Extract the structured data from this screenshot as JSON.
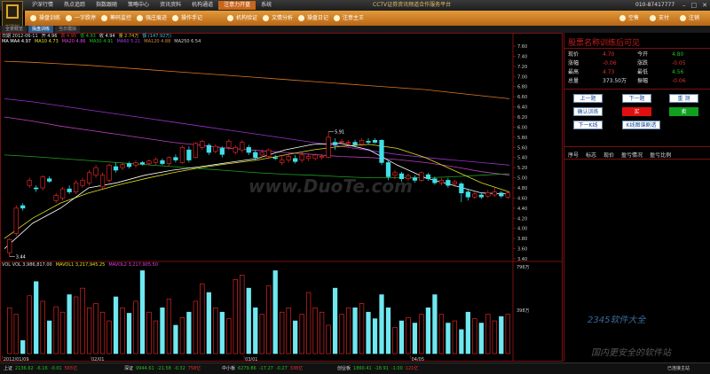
{
  "titlebar": {
    "center": "CCTV证券资讯频道合作服务平台",
    "phone": "010-87417777",
    "menu": [
      "沪深行情",
      "热点追踪",
      "指数跟随",
      "策略中心",
      "资讯资料",
      "机构通道",
      "注意力开盘",
      "系统"
    ],
    "active_menu_index": 6
  },
  "logo_text": "空间时光",
  "toolbar": {
    "items": [
      "操盘训练",
      "一字跌停",
      "筹码监控",
      "强庄痕迹",
      "操作手记",
      "机构验证",
      "文情分析",
      "操盘日记",
      "注意主王"
    ],
    "right_items": [
      "空售",
      "支付",
      "注销"
    ]
  },
  "tabs": [
    "全景概览",
    "操盘训练",
    "当日模拟"
  ],
  "active_tab": 1,
  "chart_info": {
    "line1": [
      {
        "text": "日期 2012-06-11",
        "color": "#dddddd"
      },
      {
        "text": "开 4.96",
        "color": "#e0e0e0"
      },
      {
        "text": "高 4.95",
        "color": "#e03030"
      },
      {
        "text": "低 4.93",
        "color": "#20c020"
      },
      {
        "text": "收 4.94",
        "color": "#e0e0e0"
      },
      {
        "text": "量 2.74万",
        "color": "#e0c020"
      },
      {
        "text": "额 (147.92万)",
        "color": "#40c0e0"
      }
    ],
    "line2": [
      {
        "text": "MA MA4 4.97",
        "color": "#ffffff"
      },
      {
        "text": "MA10 4.73",
        "color": "#e0e020"
      },
      {
        "text": "MA20 4.86",
        "color": "#e040e0"
      },
      {
        "text": "MA30 4.91",
        "color": "#20c020"
      },
      {
        "text": "MA60 5.21",
        "color": "#9a40e0"
      },
      {
        "text": "MA120 4.88",
        "color": "#e08040"
      },
      {
        "text": "MA250 6.54",
        "color": "#d0d0d0"
      }
    ],
    "vol": [
      {
        "text": "VOL VOL 3,986,817.00",
        "color": "#dddddd"
      },
      {
        "text": "MAVOL1 3,217,945.25",
        "color": "#e0e020"
      },
      {
        "text": "MAVOL2 3,217,905.50",
        "color": "#e040e0"
      }
    ]
  },
  "price_ticks": [
    "7.60",
    "7.40",
    "7.20",
    "7.00",
    "6.80",
    "6.60",
    "6.40",
    "6.20",
    "6.00",
    "5.80",
    "5.60",
    "5.40",
    "5.20",
    "5.00",
    "4.80",
    "4.60",
    "4.40",
    "4.20",
    "4.00",
    "3.80",
    "3.60",
    "3.40"
  ],
  "vol_ticks": [
    "796万",
    "398万"
  ],
  "date_ticks": [
    {
      "label": "2012/01/09",
      "pos": 0.003
    },
    {
      "label": "02/01",
      "pos": 0.175
    },
    {
      "label": "03/01",
      "pos": 0.475
    },
    {
      "label": "04/05",
      "pos": 0.8
    }
  ],
  "annotations": {
    "high": "5.91",
    "low": "3.44"
  },
  "watermark": "www.DuoTe.com",
  "chart_data": {
    "type": "candlestick",
    "ylim": [
      3.4,
      7.6
    ],
    "candles": [
      {
        "o": 3.52,
        "c": 3.78,
        "h": 3.8,
        "l": 3.44
      },
      {
        "o": 3.9,
        "c": 4.4,
        "h": 4.45,
        "l": 3.85
      },
      {
        "o": 4.45,
        "c": 4.4,
        "h": 4.5,
        "l": 4.35
      },
      {
        "o": 4.85,
        "c": 4.95,
        "h": 5.0,
        "l": 4.8
      },
      {
        "o": 4.8,
        "c": 4.78,
        "h": 4.85,
        "l": 4.72
      },
      {
        "o": 4.8,
        "c": 5.02,
        "h": 5.05,
        "l": 4.75
      },
      {
        "o": 4.98,
        "c": 4.93,
        "h": 5.03,
        "l": 4.9
      },
      {
        "o": 4.55,
        "c": 4.65,
        "h": 4.7,
        "l": 4.5
      },
      {
        "o": 4.6,
        "c": 4.78,
        "h": 4.82,
        "l": 4.55
      },
      {
        "o": 4.78,
        "c": 4.72,
        "h": 4.85,
        "l": 4.68
      },
      {
        "o": 4.72,
        "c": 4.9,
        "h": 4.95,
        "l": 4.68
      },
      {
        "o": 4.85,
        "c": 4.95,
        "h": 5.0,
        "l": 4.8
      },
      {
        "o": 4.9,
        "c": 5.1,
        "h": 5.15,
        "l": 4.85
      },
      {
        "o": 5.05,
        "c": 5.2,
        "h": 5.25,
        "l": 5.0
      },
      {
        "o": 4.82,
        "c": 5.05,
        "h": 5.1,
        "l": 4.78
      },
      {
        "o": 4.95,
        "c": 5.25,
        "h": 5.28,
        "l": 4.9
      },
      {
        "o": 5.22,
        "c": 5.15,
        "h": 5.3,
        "l": 5.1
      },
      {
        "o": 5.2,
        "c": 5.26,
        "h": 5.3,
        "l": 5.15
      },
      {
        "o": 5.28,
        "c": 5.22,
        "h": 5.32,
        "l": 5.18
      },
      {
        "o": 5.25,
        "c": 5.3,
        "h": 5.34,
        "l": 5.2
      },
      {
        "o": 5.3,
        "c": 5.27,
        "h": 5.33,
        "l": 5.24
      },
      {
        "o": 5.28,
        "c": 5.33,
        "h": 5.36,
        "l": 5.25
      },
      {
        "o": 5.3,
        "c": 5.36,
        "h": 5.4,
        "l": 5.26
      },
      {
        "o": 5.34,
        "c": 5.28,
        "h": 5.38,
        "l": 5.25
      },
      {
        "o": 5.28,
        "c": 5.4,
        "h": 5.42,
        "l": 5.24
      },
      {
        "o": 5.4,
        "c": 5.35,
        "h": 5.46,
        "l": 5.3
      },
      {
        "o": 5.3,
        "c": 5.6,
        "h": 5.64,
        "l": 5.28
      },
      {
        "o": 5.55,
        "c": 5.35,
        "h": 5.62,
        "l": 5.3
      },
      {
        "o": 5.4,
        "c": 5.68,
        "h": 5.7,
        "l": 5.38
      },
      {
        "o": 5.6,
        "c": 5.72,
        "h": 5.75,
        "l": 5.55
      },
      {
        "o": 5.64,
        "c": 5.5,
        "h": 5.68,
        "l": 5.45
      },
      {
        "o": 5.52,
        "c": 5.62,
        "h": 5.66,
        "l": 5.48
      },
      {
        "o": 5.58,
        "c": 5.46,
        "h": 5.62,
        "l": 5.4
      },
      {
        "o": 5.6,
        "c": 5.72,
        "h": 5.76,
        "l": 5.55
      },
      {
        "o": 5.5,
        "c": 5.6,
        "h": 5.64,
        "l": 5.46
      },
      {
        "o": 5.55,
        "c": 5.7,
        "h": 5.74,
        "l": 5.5
      },
      {
        "o": 5.6,
        "c": 5.5,
        "h": 5.65,
        "l": 5.45
      },
      {
        "o": 5.5,
        "c": 5.4,
        "h": 5.55,
        "l": 5.35
      },
      {
        "o": 5.45,
        "c": 5.5,
        "h": 5.55,
        "l": 5.4
      },
      {
        "o": 5.42,
        "c": 5.55,
        "h": 5.58,
        "l": 5.38
      },
      {
        "o": 5.4,
        "c": 5.38,
        "h": 5.45,
        "l": 5.35
      },
      {
        "o": 5.3,
        "c": 5.35,
        "h": 5.45,
        "l": 5.25
      },
      {
        "o": 5.35,
        "c": 5.42,
        "h": 5.48,
        "l": 5.3
      },
      {
        "o": 5.38,
        "c": 5.32,
        "h": 5.45,
        "l": 5.28
      },
      {
        "o": 5.35,
        "c": 5.45,
        "h": 5.5,
        "l": 5.3
      },
      {
        "o": 5.38,
        "c": 5.42,
        "h": 5.46,
        "l": 5.33
      },
      {
        "o": 5.38,
        "c": 5.45,
        "h": 5.48,
        "l": 5.34
      },
      {
        "o": 5.4,
        "c": 5.42,
        "h": 5.46,
        "l": 5.36
      },
      {
        "o": 5.4,
        "c": 5.8,
        "h": 5.91,
        "l": 5.38
      },
      {
        "o": 5.7,
        "c": 5.65,
        "h": 5.78,
        "l": 5.55
      },
      {
        "o": 5.7,
        "c": 5.72,
        "h": 5.76,
        "l": 5.65
      },
      {
        "o": 5.68,
        "c": 5.7,
        "h": 5.74,
        "l": 5.6
      },
      {
        "o": 5.7,
        "c": 5.65,
        "h": 5.75,
        "l": 5.6
      },
      {
        "o": 5.66,
        "c": 5.74,
        "h": 5.78,
        "l": 5.62
      },
      {
        "o": 5.72,
        "c": 5.7,
        "h": 5.78,
        "l": 5.66
      },
      {
        "o": 5.74,
        "c": 5.7,
        "h": 5.78,
        "l": 5.68
      },
      {
        "o": 5.74,
        "c": 5.3,
        "h": 5.76,
        "l": 5.25
      },
      {
        "o": 5.3,
        "c": 5.02,
        "h": 5.35,
        "l": 4.95
      },
      {
        "o": 5.05,
        "c": 5.1,
        "h": 5.15,
        "l": 4.98
      },
      {
        "o": 5.08,
        "c": 4.98,
        "h": 5.12,
        "l": 4.92
      },
      {
        "o": 4.98,
        "c": 5.04,
        "h": 5.08,
        "l": 4.94
      },
      {
        "o": 5.0,
        "c": 4.95,
        "h": 5.05,
        "l": 4.9
      },
      {
        "o": 4.95,
        "c": 5.1,
        "h": 5.12,
        "l": 4.92
      },
      {
        "o": 5.06,
        "c": 4.98,
        "h": 5.1,
        "l": 4.94
      },
      {
        "o": 4.98,
        "c": 4.9,
        "h": 5.02,
        "l": 4.86
      },
      {
        "o": 4.9,
        "c": 4.95,
        "h": 5.0,
        "l": 4.85
      },
      {
        "o": 4.95,
        "c": 4.85,
        "h": 5.0,
        "l": 4.8
      },
      {
        "o": 4.88,
        "c": 4.92,
        "h": 4.96,
        "l": 4.82
      },
      {
        "o": 4.88,
        "c": 4.7,
        "h": 4.92,
        "l": 4.52
      },
      {
        "o": 4.72,
        "c": 4.62,
        "h": 4.78,
        "l": 4.55
      },
      {
        "o": 4.62,
        "c": 4.68,
        "h": 4.72,
        "l": 4.58
      },
      {
        "o": 4.66,
        "c": 4.62,
        "h": 4.7,
        "l": 4.58
      },
      {
        "o": 4.64,
        "c": 4.7,
        "h": 4.76,
        "l": 4.6
      },
      {
        "o": 4.66,
        "c": 4.72,
        "h": 4.8,
        "l": 4.62
      },
      {
        "o": 4.7,
        "c": 4.64,
        "h": 4.74,
        "l": 4.6
      },
      {
        "o": 4.62,
        "c": 4.7,
        "h": 4.74,
        "l": 4.58
      }
    ],
    "ma_lines": [
      {
        "name": "MA250",
        "color": "#e07820",
        "values": [
          7.3,
          7.28,
          7.25,
          7.22,
          7.18,
          7.14,
          7.1,
          7.06,
          7.02,
          6.98,
          6.94,
          6.9,
          6.86,
          6.82,
          6.78,
          6.74,
          6.68,
          6.62,
          6.56
        ]
      },
      {
        "name": "MA120",
        "color": "#9a30d0",
        "values": [
          6.56,
          6.5,
          6.42,
          6.34,
          6.26,
          6.18,
          6.1,
          6.02,
          5.94,
          5.86,
          5.78,
          5.7,
          5.62,
          5.54,
          5.46,
          5.4,
          5.35,
          5.3,
          5.25
        ]
      },
      {
        "name": "MA60",
        "color": "#c040c0",
        "values": [
          6.2,
          6.12,
          6.02,
          5.94,
          5.86,
          5.78,
          5.7,
          5.64,
          5.58,
          5.54,
          5.5,
          5.46,
          5.42,
          5.4,
          5.36,
          5.3,
          5.22,
          5.12,
          5.05
        ]
      },
      {
        "name": "MA30",
        "color": "#20a020",
        "values": [
          5.45,
          5.42,
          5.38,
          5.34,
          5.3,
          5.26,
          5.22,
          5.18,
          5.14,
          5.1,
          5.07,
          5.05,
          5.02,
          5.0,
          5.0,
          5.0,
          5.02,
          5.05,
          5.08
        ]
      },
      {
        "name": "MA10",
        "color": "#e0e020",
        "values": [
          3.8,
          4.2,
          4.5,
          4.7,
          4.85,
          4.98,
          5.1,
          5.2,
          5.28,
          5.35,
          5.45,
          5.55,
          5.62,
          5.66,
          5.58,
          5.4,
          5.15,
          4.9,
          4.72
        ]
      },
      {
        "name": "MA5",
        "color": "#ffffff",
        "values": [
          3.6,
          4.1,
          4.4,
          4.8,
          4.9,
          5.05,
          5.15,
          5.22,
          5.3,
          5.38,
          5.55,
          5.66,
          5.68,
          5.55,
          5.25,
          5.0,
          4.85,
          4.7,
          4.68
        ]
      }
    ],
    "volume": {
      "ylim": [
        0,
        796
      ],
      "values": [
        420,
        360,
        120,
        530,
        660,
        480,
        300,
        430,
        380,
        540,
        520,
        600,
        420,
        460,
        380,
        300,
        520,
        420,
        370,
        480,
        760,
        380,
        300,
        420,
        500,
        260,
        330,
        380,
        480,
        640,
        560,
        420,
        380,
        320,
        680,
        720,
        600,
        420,
        360,
        620,
        760,
        380,
        420,
        300,
        360,
        560,
        420,
        380,
        260,
        600,
        360,
        420,
        420,
        460,
        380,
        320,
        540,
        420,
        240,
        300,
        330,
        280,
        360,
        420,
        540,
        360,
        280,
        300,
        220,
        380,
        320,
        280,
        360,
        300,
        340,
        360
      ]
    }
  },
  "panel": {
    "title": "股票名称训练后可见",
    "quote_rows": [
      [
        {
          "t": "现价",
          "c": "lbl"
        },
        {
          "t": "4.70",
          "c": "v"
        },
        {
          "t": "今开",
          "c": "lbl"
        },
        {
          "t": "4.80",
          "c": "vg"
        }
      ],
      [
        {
          "t": "涨幅",
          "c": "lbl"
        },
        {
          "t": "-0.06",
          "c": "v"
        },
        {
          "t": "涨跌",
          "c": "lbl"
        },
        {
          "t": "-0.05",
          "c": "v"
        }
      ],
      [
        {
          "t": "最高",
          "c": "lbl"
        },
        {
          "t": "4.73",
          "c": "v"
        },
        {
          "t": "最低",
          "c": "lbl"
        },
        {
          "t": "4.56",
          "c": "vg"
        }
      ],
      [
        {
          "t": "总量",
          "c": "lbl"
        },
        {
          "t": "373.50万",
          "c": "lbl"
        },
        {
          "t": "振幅",
          "c": "lbl"
        },
        {
          "t": "-0.06",
          "c": "v"
        }
      ]
    ],
    "buttons": {
      "prev": "上一题",
      "next": "下一题",
      "reset": "重 测",
      "dir": "确认训练",
      "buy": "买",
      "sell": "卖",
      "next_k": "下一K线",
      "analyze": "K线图谱剧透"
    },
    "history_headers": [
      "序号",
      "标志",
      "现价",
      "盈亏情况",
      "盈亏比例"
    ]
  },
  "statusbar": [
    {
      "label": "上证",
      "value": "2136.62",
      "chg": "-6.16",
      "pct": "-0.01",
      "amt": "565亿"
    },
    {
      "label": "深证",
      "value": "9944.61",
      "chg": "-21.58",
      "pct": "-0.32",
      "amt": "758亿"
    },
    {
      "label": "中小板",
      "value": "6279.86",
      "chg": "-17.27",
      "pct": "-0.27",
      "amt": "336亿"
    },
    {
      "label": "创业板",
      "value": "1860.41",
      "chg": "-18.91",
      "pct": "-1.00",
      "amt": "121亿"
    }
  ],
  "status_right": "已连接主站",
  "brand_watermark": {
    "line1": "2345软件大全",
    "line2": "国内更安全的软件站"
  }
}
